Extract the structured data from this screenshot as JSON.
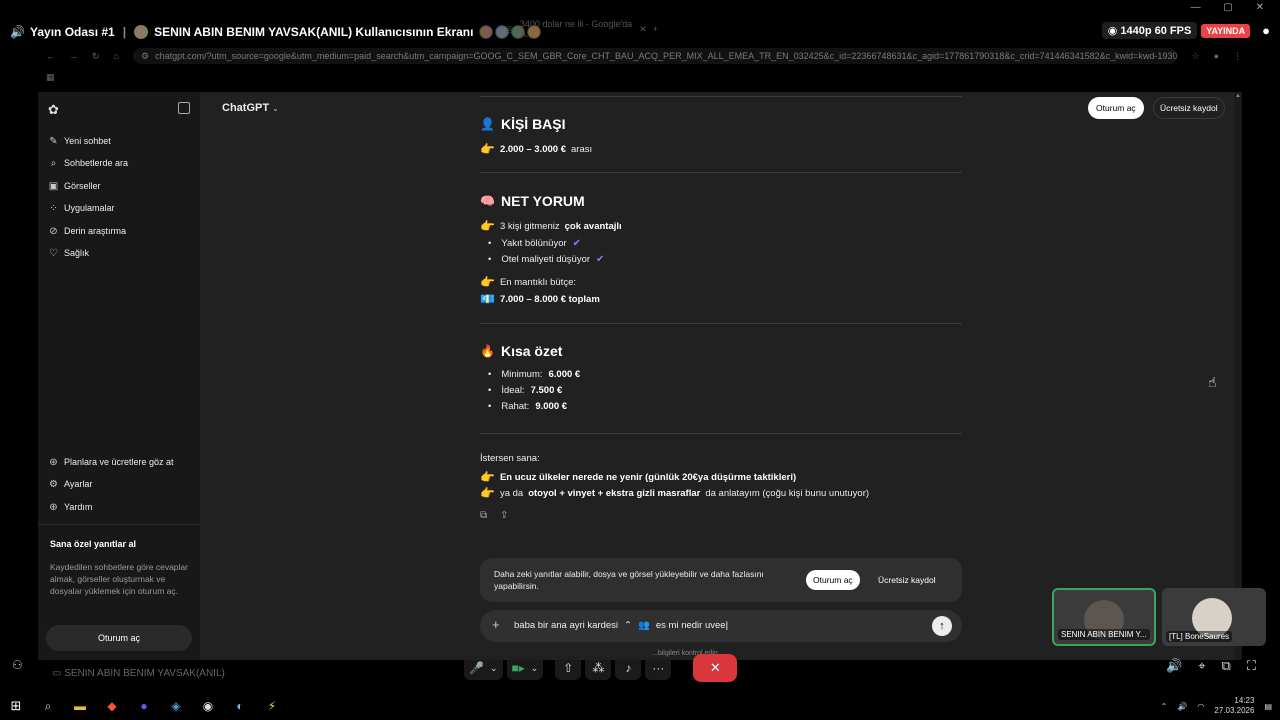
{
  "stream": {
    "channel": "Yayın Odası #1",
    "title": "SENIN ABIN BENIM YAVSAK(ANIL) Kullanıcısının Ekranı",
    "quality": "1440p 60 FPS",
    "live": "YAYINDA",
    "viewer_name": "SENIN ABIN BENIM YAVSAK(ANIL)"
  },
  "browser": {
    "tab_title": "3400 dolar ne ili - Google'da A...",
    "url": "chatgpt.com/?utm_source=google&utm_medium=paid_search&utm_campaign=GOOG_C_SEM_GBR_Core_CHT_BAU_ACQ_PER_MIX_ALL_EMEA_TR_EN_032425&c_id=22366748631&c_agid=177861790318&c_crid=741446341582&c_kwid=kwd-193088318565..."
  },
  "sidebar": {
    "items": [
      {
        "icon": "edit-icon",
        "label": "Yeni sohbet"
      },
      {
        "icon": "search-icon",
        "label": "Sohbetlerde ara"
      },
      {
        "icon": "image-icon",
        "label": "Görseller"
      },
      {
        "icon": "apps-icon",
        "label": "Uygulamalar"
      },
      {
        "icon": "research-icon",
        "label": "Derin araştırma"
      },
      {
        "icon": "heart-icon",
        "label": "Sağlık"
      }
    ],
    "bottom_items": [
      {
        "icon": "plans-icon",
        "label": "Planlara ve ücretlere göz at"
      },
      {
        "icon": "settings-icon",
        "label": "Ayarlar"
      },
      {
        "icon": "help-icon",
        "label": "Yardım"
      }
    ],
    "promo_title": "Sana özel yanıtlar al",
    "promo_desc": "Kaydedilen sohbetlere göre cevaplar almak, görseller oluşturmak ve dosyalar yüklemek için oturum aç.",
    "login_label": "Oturum aç"
  },
  "header": {
    "model": "ChatGPT",
    "login": "Oturum aç",
    "signup": "Ücretsiz kaydol"
  },
  "content": {
    "per_person_title": "KİŞİ BAŞI",
    "per_person_value": "2.000 – 3.000 €",
    "per_person_suffix": "arası",
    "net_title": "NET YORUM",
    "net_intro": "3 kişi gitmeniz",
    "net_intro_bold": "çok avantajlı",
    "net_bullets": [
      "Yakıt bölünüyor",
      "Otel maliyeti düşüyor"
    ],
    "budget_label": "En mantıklı bütçe:",
    "budget_value": "7.000 – 8.000 € toplam",
    "summary_title": "Kısa özet",
    "summary_items": [
      {
        "label": "Minimum:",
        "value": "6.000 €"
      },
      {
        "label": "İdeal:",
        "value": "7.500 €"
      },
      {
        "label": "Rahat:",
        "value": "9.000 €"
      }
    ],
    "offer_intro": "İstersen sana:",
    "offer_1": "En ucuz ülkeler nerede ne yenir (günlük 20€ya düşürme taktikleri)",
    "offer_2_pre": "ya da",
    "offer_2_bold": "otoyol + vinyet + ekstra gizli masraflar",
    "offer_2_post": "da anlatayım (çoğu kişi bunu unutuyor)"
  },
  "upsell": {
    "text": "Daha zeki yanıtlar alabilir, dosya ve görsel yükleyebilir ve daha fazlasını yapabilirsin.",
    "login": "Oturum aç",
    "signup": "Ücretsiz kaydol"
  },
  "composer": {
    "value": "baba bir ana ayri kardesi",
    "value_tail": "es mi nedir uvee"
  },
  "disclaimer": "...bilgileri kontrol edin.",
  "cameras": [
    {
      "label": "SENIN ABIN BENIM Y..."
    },
    {
      "label": "[TL] BoneSaures"
    }
  ],
  "clock": {
    "time": "14:23",
    "date": "27.03.2026"
  }
}
